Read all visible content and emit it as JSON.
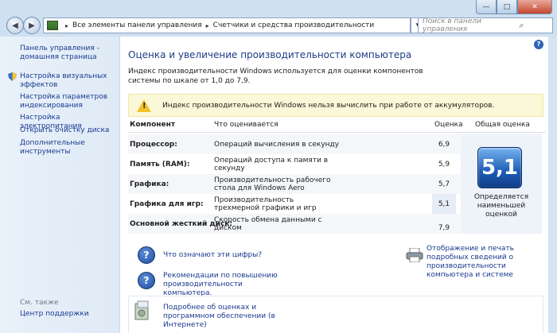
{
  "window": {
    "min": "—",
    "max": "□",
    "close": "✕"
  },
  "nav": {
    "back": "◀",
    "forward": "▶"
  },
  "address": {
    "crumbs": [
      "Все элементы панели управления",
      "Счетчики и средства производительности"
    ],
    "separator": "▸",
    "dropdown": "▾"
  },
  "search": {
    "placeholder": "Поиск в панели управления"
  },
  "sidebar": {
    "items": [
      "Панель управления - домашняя страница",
      "Настройка визуальных эффектов",
      "Настройка параметров индексирования",
      "Настройка электропитания",
      "Открыть очистку диска",
      "Дополнительные инструменты"
    ],
    "see_also": "См. также",
    "support": "Центр поддержки"
  },
  "main": {
    "title": "Оценка и увеличение производительности компьютера",
    "intro": "Индекс производительности Windows используется для оценки компонентов системы по шкале от 1,0 до 7,9.",
    "warning": "Индекс производительности Windows нельзя вычислить при работе от аккумуляторов.",
    "headers": {
      "component": "Компонент",
      "what": "Что оценивается",
      "score": "Оценка",
      "total": "Общая оценка"
    },
    "rows": [
      {
        "component": "Процессор:",
        "what": "Операций вычисления в секунду",
        "score": "6,9"
      },
      {
        "component": "Память (RAM):",
        "what": "Операций доступа к памяти в секунду",
        "score": "5,9"
      },
      {
        "component": "Графика:",
        "what": "Производительность рабочего стола для Windows Aero",
        "score": "5,7"
      },
      {
        "component": "Графика для игр:",
        "what": "Производительность трехмерной графики и игр",
        "score": "5,1"
      },
      {
        "component": "Основной жесткий диск:",
        "what": "Скорость обмена данными с диском",
        "score": "7,9"
      }
    ],
    "base_score": "5,1",
    "base_caption": "Определяется наименьшей оценкой",
    "links": {
      "meaning": "Что означают эти цифры?",
      "tips": "Рекомендации по повышению производительности компьютера.",
      "print": "Отображение и печать подробных сведений о производительности компьютера и системе",
      "online": "Подробнее об оценках и программном обеспечении (в Интернете)"
    },
    "help": "?"
  },
  "colors": {
    "link": "#1a3a8f",
    "title": "#1d3c86",
    "accent": "#1e5cb4",
    "warning_bg": "#fbf8d9"
  }
}
